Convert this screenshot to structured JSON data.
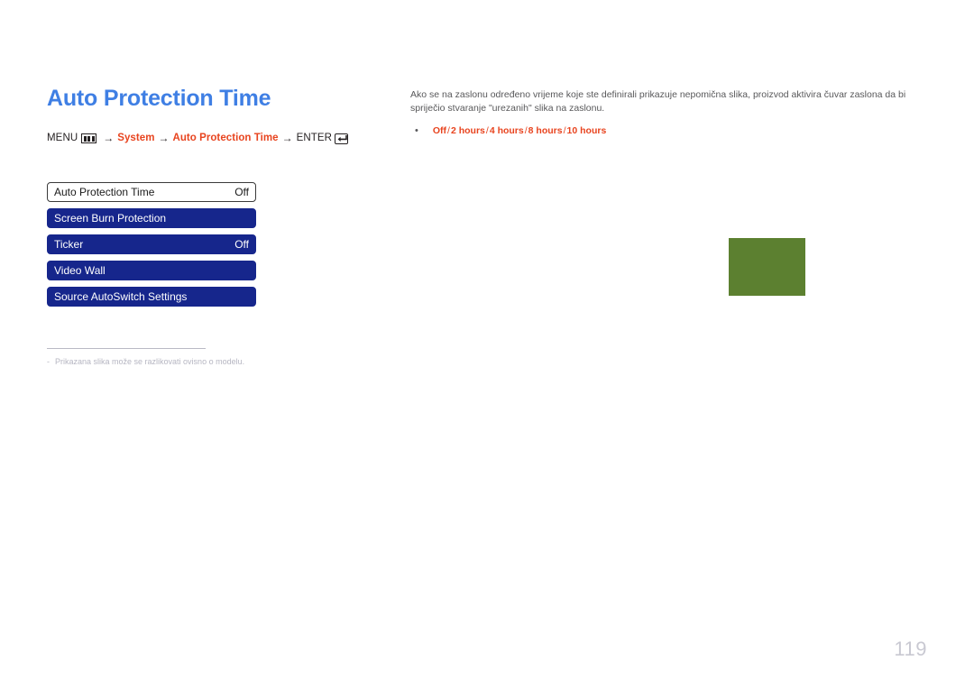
{
  "page": {
    "title": "Auto Protection Time",
    "number": "119"
  },
  "breadcrumb": {
    "menu_label": "MENU",
    "menu_icon": "menu-box-icon",
    "arrow": "→",
    "step1": "System",
    "step2": "Auto Protection Time",
    "enter_label": "ENTER",
    "enter_icon": "enter-return-icon"
  },
  "osd": {
    "rows": [
      {
        "label": "Auto Protection Time",
        "value": "Off",
        "state": "selected"
      },
      {
        "label": "Screen Burn Protection",
        "value": "",
        "state": "normal"
      },
      {
        "label": "Ticker",
        "value": "Off",
        "state": "normal"
      },
      {
        "label": "Video Wall",
        "value": "",
        "state": "normal"
      },
      {
        "label": "Source AutoSwitch Settings",
        "value": "",
        "state": "normal"
      }
    ]
  },
  "description": {
    "paragraph": "Ako se na zaslonu određeno vrijeme koje ste definirali prikazuje nepomična slika, proizvod aktivira čuvar zaslona da bi spriječio stvaranje \"urezanih\" slika na zaslonu.",
    "bullet_mark": "•",
    "options": [
      "Off",
      "2 hours",
      "4 hours",
      "8 hours",
      "10 hours"
    ],
    "option_separator": "/"
  },
  "footnote": {
    "dash": "-",
    "text": "Prikazana slika može se razlikovati ovisno o modelu."
  },
  "colors": {
    "title_blue": "#3f7fe4",
    "accent_orange": "#e8441f",
    "osd_blue": "#16268c",
    "olive": "#5c8030",
    "page_number_gray": "#c9c9d2"
  }
}
